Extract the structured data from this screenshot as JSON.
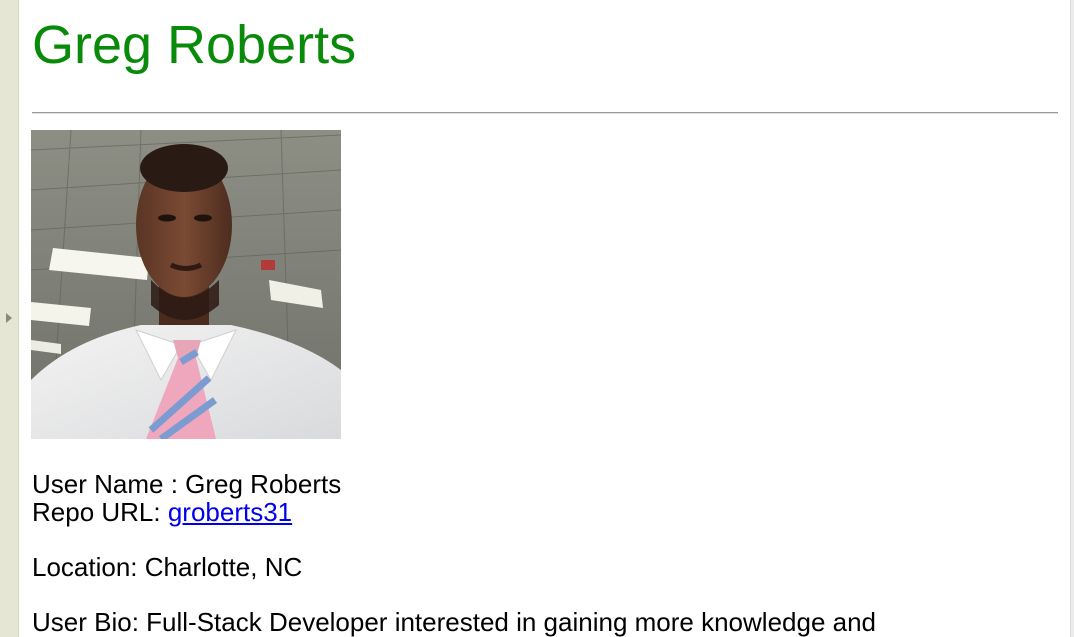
{
  "profile": {
    "title": "Greg Roberts",
    "user_name_label": "User Name : ",
    "user_name": "Greg Roberts",
    "repo_label": "Repo URL: ",
    "repo_link_text": "groberts31",
    "location_label": "Location: ",
    "location": "Charlotte, NC",
    "bio_label": "User Bio: ",
    "bio": "Full-Stack Developer interested in gaining more knowledge and"
  },
  "colors": {
    "title": "#0a8a0a",
    "link": "#0000ee",
    "left_rail": "#e6e6d4"
  },
  "icons": {
    "rail_toggle": "triangle-right-icon"
  }
}
